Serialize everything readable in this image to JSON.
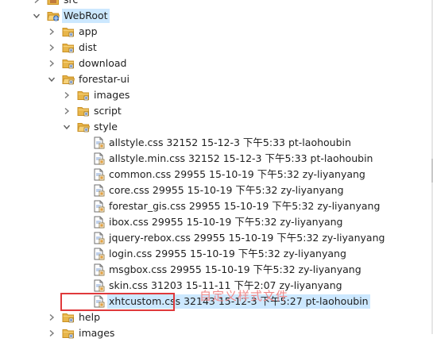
{
  "tree": [
    {
      "label": "src",
      "depth": 0,
      "kind": "src",
      "expanded": false
    },
    {
      "label": "WebRoot",
      "depth": 0,
      "kind": "webroot",
      "expanded": true,
      "highlighted": true
    },
    {
      "label": "app",
      "depth": 1,
      "kind": "folder",
      "expanded": false
    },
    {
      "label": "dist",
      "depth": 1,
      "kind": "folder",
      "expanded": false
    },
    {
      "label": "download",
      "depth": 1,
      "kind": "folder",
      "expanded": false
    },
    {
      "label": "forestar-ui",
      "depth": 1,
      "kind": "folder",
      "expanded": true
    },
    {
      "label": "images",
      "depth": 2,
      "kind": "folder",
      "expanded": false
    },
    {
      "label": "script",
      "depth": 2,
      "kind": "folder",
      "expanded": false
    },
    {
      "label": "style",
      "depth": 2,
      "kind": "folder",
      "expanded": true
    },
    {
      "label": "allstyle.css 32152  15-12-3 下午5:33  pt-laohoubin",
      "depth": 3,
      "kind": "file"
    },
    {
      "label": "allstyle.min.css 32152  15-12-3 下午5:33  pt-laohoubin",
      "depth": 3,
      "kind": "file"
    },
    {
      "label": "common.css 29955  15-10-19 下午5:32  zy-liyanyang",
      "depth": 3,
      "kind": "file"
    },
    {
      "label": "core.css 29955  15-10-19 下午5:32  zy-liyanyang",
      "depth": 3,
      "kind": "file"
    },
    {
      "label": "forestar_gis.css 29955  15-10-19 下午5:32  zy-liyanyang",
      "depth": 3,
      "kind": "file"
    },
    {
      "label": "ibox.css 29955  15-10-19 下午5:32  zy-liyanyang",
      "depth": 3,
      "kind": "file"
    },
    {
      "label": "jquery-rebox.css 29955  15-10-19 下午5:32  zy-liyanyang",
      "depth": 3,
      "kind": "file"
    },
    {
      "label": "login.css 29955  15-10-19 下午5:32  zy-liyanyang",
      "depth": 3,
      "kind": "file"
    },
    {
      "label": "msgbox.css 29955  15-10-19 下午5:32  zy-liyanyang",
      "depth": 3,
      "kind": "file"
    },
    {
      "label": "skin.css 31203  15-11-11 下午2:07  zy-liyanyang",
      "depth": 3,
      "kind": "file"
    },
    {
      "label": "xhtcustom.css 32143  15-12-3 下午5:27  pt-laohoubin",
      "depth": 3,
      "kind": "file",
      "selected": true
    },
    {
      "label": "help",
      "depth": 1,
      "kind": "folder",
      "expanded": false
    },
    {
      "label": "images",
      "depth": 1,
      "kind": "folder",
      "expanded": false
    }
  ],
  "annotation": {
    "text": "自定义样式文件"
  },
  "colors": {
    "selection": "#cce8ff",
    "highlight_box": "#e0393b",
    "annotation_text": "#f08a8a",
    "folder": "#e8b64a",
    "folder_dark": "#c98f22",
    "chevron": "#6b6b6b"
  }
}
